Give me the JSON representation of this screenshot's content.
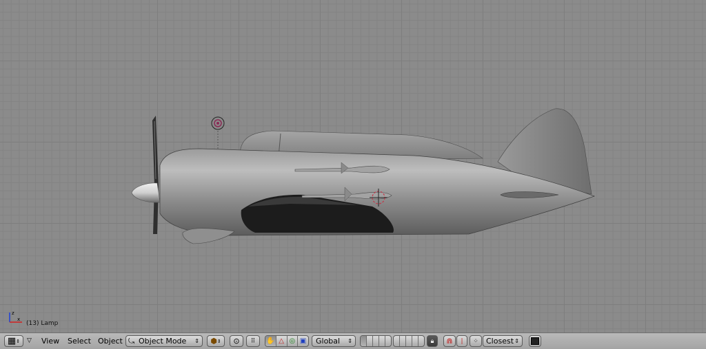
{
  "viewport": {
    "object_label": "(13) Lamp",
    "axis": {
      "z_label": "z",
      "x_label": "x"
    }
  },
  "header": {
    "menus": {
      "view": "View",
      "select": "Select",
      "object": "Object"
    },
    "mode": {
      "label": "Object Mode",
      "icon": "object-mode-icon"
    },
    "orientation": {
      "label": "Global"
    },
    "snap": {
      "label": "Closest"
    }
  }
}
